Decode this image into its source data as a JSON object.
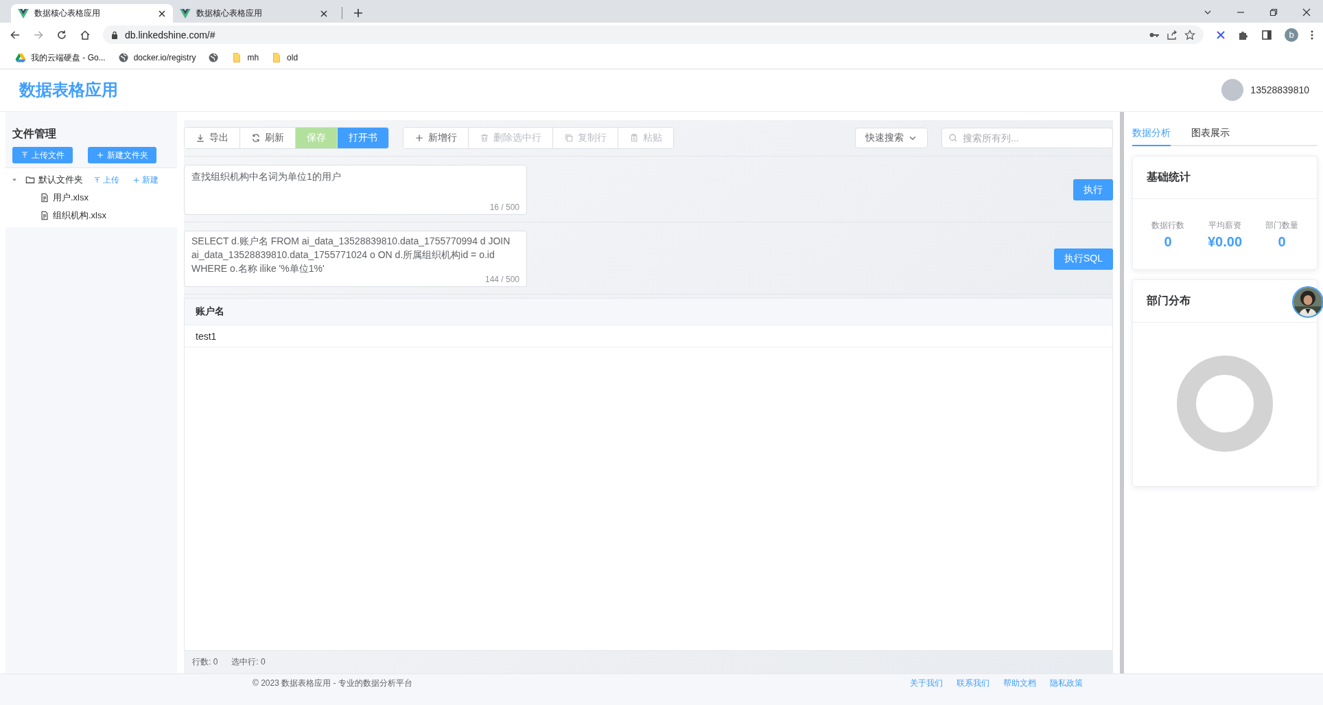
{
  "browser": {
    "tabs": [
      {
        "title": "数据核心表格应用",
        "selected": true
      },
      {
        "title": "数据核心表格应用",
        "selected": false
      }
    ],
    "address": "db.linkedshine.com/#",
    "profile": "b",
    "bookmarks": [
      {
        "kind": "drive",
        "label": "我的云端硬盘 - Go..."
      },
      {
        "kind": "globe",
        "label": "docker.io/registry"
      },
      {
        "kind": "globe"
      },
      {
        "kind": "folder",
        "label": "mh"
      },
      {
        "kind": "folder",
        "label": "old"
      }
    ]
  },
  "app": {
    "title": "数据表格应用",
    "user": "13528839810"
  },
  "sidebar": {
    "title": "文件管理",
    "buttons": [
      "上传文件",
      "新建文件夹"
    ],
    "tree": [
      {
        "label": "默认文件夹",
        "expanded": true,
        "actions": [
          "上传",
          "新建"
        ],
        "children": [
          {
            "label": "用户.xlsx"
          },
          {
            "label": "组织机构.xlsx"
          }
        ]
      }
    ]
  },
  "toolbar": {
    "groups": [
      [
        {
          "label": "导出",
          "kind": "plain",
          "disabled": false
        },
        {
          "label": "刷新",
          "kind": "plain",
          "disabled": false
        },
        {
          "label": "保存",
          "kind": "success",
          "disabled": true
        },
        {
          "label": "打开书",
          "kind": "primary",
          "disabled": false
        }
      ],
      [
        {
          "label": "新增行",
          "kind": "plain",
          "disabled": false
        },
        {
          "label": "删除选中行",
          "kind": "plain",
          "disabled": true
        },
        {
          "label": "复制行",
          "kind": "plain",
          "disabled": true
        },
        {
          "label": "粘贴",
          "kind": "plain",
          "disabled": true
        }
      ]
    ],
    "quick_search": "快速搜索",
    "search": {
      "placeholder": "搜索所有列..."
    }
  },
  "query": {
    "value": "查找组织机构中名词为单位1的用户",
    "counter": "16 / 500",
    "button": "执行"
  },
  "sql": {
    "value": "SELECT d.账户名 FROM ai_data_13528839810.data_1755770994 d JOIN ai_data_13528839810.data_1755771024 o ON d.所属组织机构id = o.id WHERE o.名称 ilike '%单位1%'",
    "counter": "144 / 500",
    "button": "执行SQL"
  },
  "table": {
    "columns": [
      "账户名"
    ],
    "rows": [
      [
        "test1"
      ]
    ]
  },
  "status": [
    "行数: 0",
    "选中行: 0"
  ],
  "panel": {
    "tabs": [
      {
        "label": "数据分析",
        "selected": true
      },
      {
        "label": "图表展示",
        "selected": false
      }
    ],
    "stats": {
      "title": "基础统计",
      "items": [
        {
          "label": "数据行数",
          "value": "0"
        },
        {
          "label": "平均薪资",
          "value": "¥0.00"
        },
        {
          "label": "部门数量",
          "value": "0"
        }
      ]
    },
    "distribution": {
      "title": "部门分布"
    }
  },
  "footer": {
    "copyright": "© 2023 数据表格应用 - 专业的数据分析平台",
    "links": [
      "关于我们",
      "联系我们",
      "帮助文档",
      "隐私政策"
    ]
  }
}
